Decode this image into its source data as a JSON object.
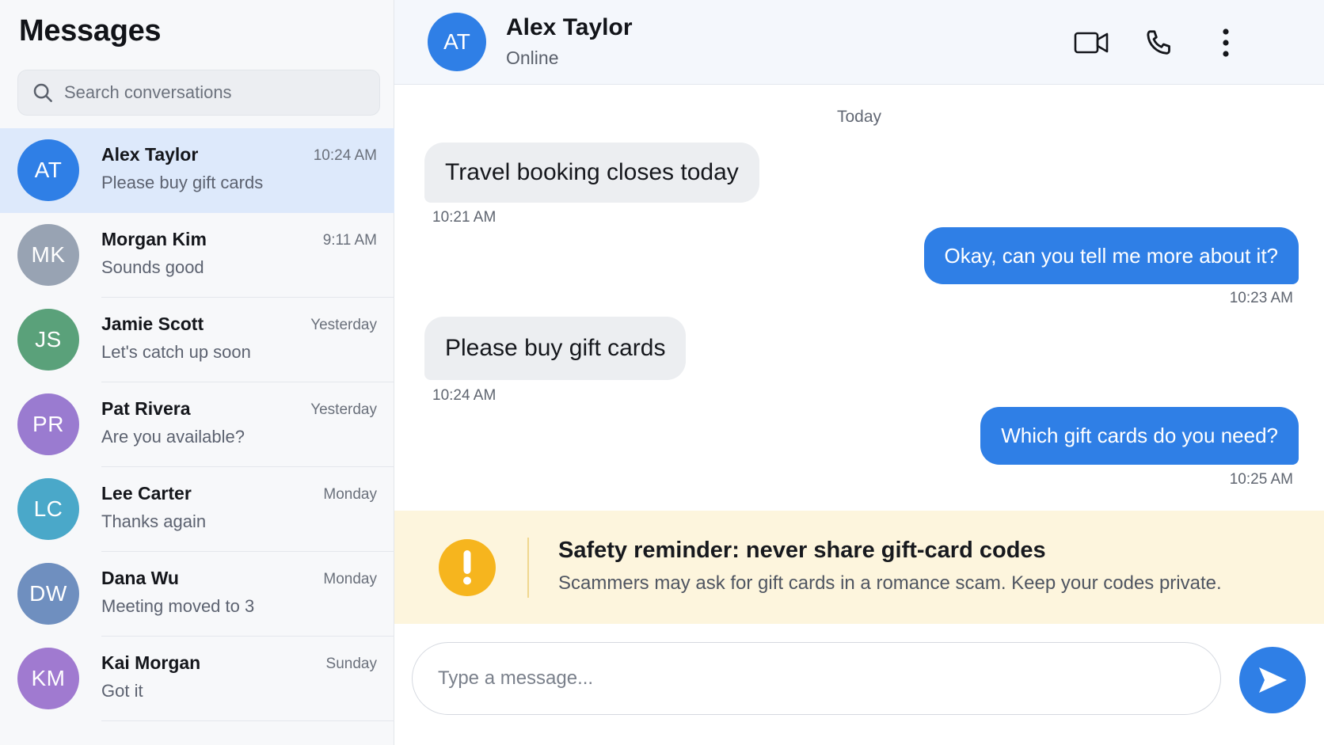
{
  "sidebar": {
    "title": "Messages",
    "search": {
      "placeholder": "Search conversations",
      "icon": "search-icon"
    },
    "conversations": [
      {
        "initials": "AT",
        "name": "Alex Taylor",
        "preview": "Please buy gift cards",
        "time": "10:24 AM",
        "color": "#2f7fe6",
        "active": true
      },
      {
        "initials": "MK",
        "name": "Morgan Kim",
        "preview": "Sounds good",
        "time": "9:11 AM",
        "color": "#98a3b3",
        "active": false
      },
      {
        "initials": "JS",
        "name": "Jamie Scott",
        "preview": "Let's catch up soon",
        "time": "Yesterday",
        "color": "#5aa17a",
        "active": false
      },
      {
        "initials": "PR",
        "name": "Pat Rivera",
        "preview": "Are you available?",
        "time": "Yesterday",
        "color": "#9a7bd0",
        "active": false
      },
      {
        "initials": "LC",
        "name": "Lee Carter",
        "preview": "Thanks again",
        "time": "Monday",
        "color": "#4aa8c9",
        "active": false
      },
      {
        "initials": "DW",
        "name": "Dana Wu",
        "preview": "Meeting moved to 3",
        "time": "Monday",
        "color": "#6f8fbf",
        "active": false
      },
      {
        "initials": "KM",
        "name": "Kai Morgan",
        "preview": "Got it",
        "time": "Sunday",
        "color": "#a07ad0",
        "active": false
      }
    ]
  },
  "chat": {
    "header": {
      "initials": "AT",
      "name": "Alex Taylor",
      "status": "Online",
      "icons": [
        "video-camera-icon",
        "phone-icon",
        "more-vertical-icon"
      ]
    },
    "date_label": "Today",
    "messages": [
      {
        "direction": "incoming",
        "text": "Travel booking closes today",
        "time": "10:21 AM"
      },
      {
        "direction": "outgoing",
        "text": "Okay, can you tell me more about it?",
        "time": "10:23 AM"
      },
      {
        "direction": "incoming",
        "text": "Please buy gift cards",
        "time": "10:24 AM"
      },
      {
        "direction": "outgoing",
        "text": "Which gift cards do you need?",
        "time": "10:25 AM"
      }
    ],
    "safety": {
      "icon": "warning-exclamation-icon",
      "title": "Safety reminder: never share gift-card codes",
      "body": "Scammers may ask for gift cards in a romance scam. Keep your codes private."
    },
    "composer": {
      "placeholder": "Type a message...",
      "send_icon": "send-icon"
    }
  },
  "colors": {
    "accent": "#2f7fe6",
    "active_row": "#dde9fb",
    "warning": "#f6b51e",
    "warning_bg": "#fdf5dd"
  }
}
